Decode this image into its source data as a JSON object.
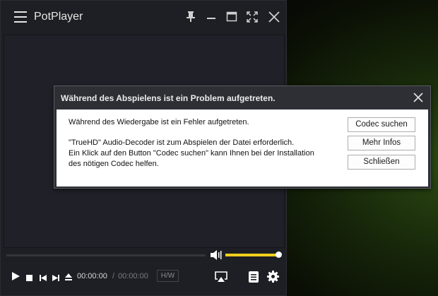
{
  "app": {
    "title": "PotPlayer"
  },
  "playback": {
    "current_time": "00:00:00",
    "separator": "/",
    "total_time": "00:00:00",
    "hw_label": "H/W",
    "volume_level": 0.92
  },
  "dialog": {
    "title": "Während des Abspielens ist ein Problem aufgetreten.",
    "message_line1": "Während des Wiedergabe ist ein Fehler aufgetreten.",
    "message_line2": "\"TrueHD\" Audio-Decoder ist zum Abspielen der Datei erforderlich.",
    "message_line3": "Ein Klick auf den Button \"Codec suchen\" kann Ihnen bei der Installation",
    "message_line4": "des nötigen Codec helfen.",
    "buttons": {
      "codec_search": "Codec suchen",
      "more_info": "Mehr Infos",
      "close": "Schließen"
    }
  },
  "colors": {
    "accent_volume": "#f1cf1c",
    "player_bg": "#1e1f24",
    "dialog_header": "#2d2f34"
  },
  "icons": [
    "menu-icon",
    "pin-icon",
    "minimize-icon",
    "maximize-icon",
    "fullscreen-icon",
    "close-icon",
    "volume-icon",
    "play-icon",
    "stop-icon",
    "previous-icon",
    "next-icon",
    "eject-icon",
    "cast-icon",
    "playlist-icon",
    "settings-gear-icon"
  ]
}
